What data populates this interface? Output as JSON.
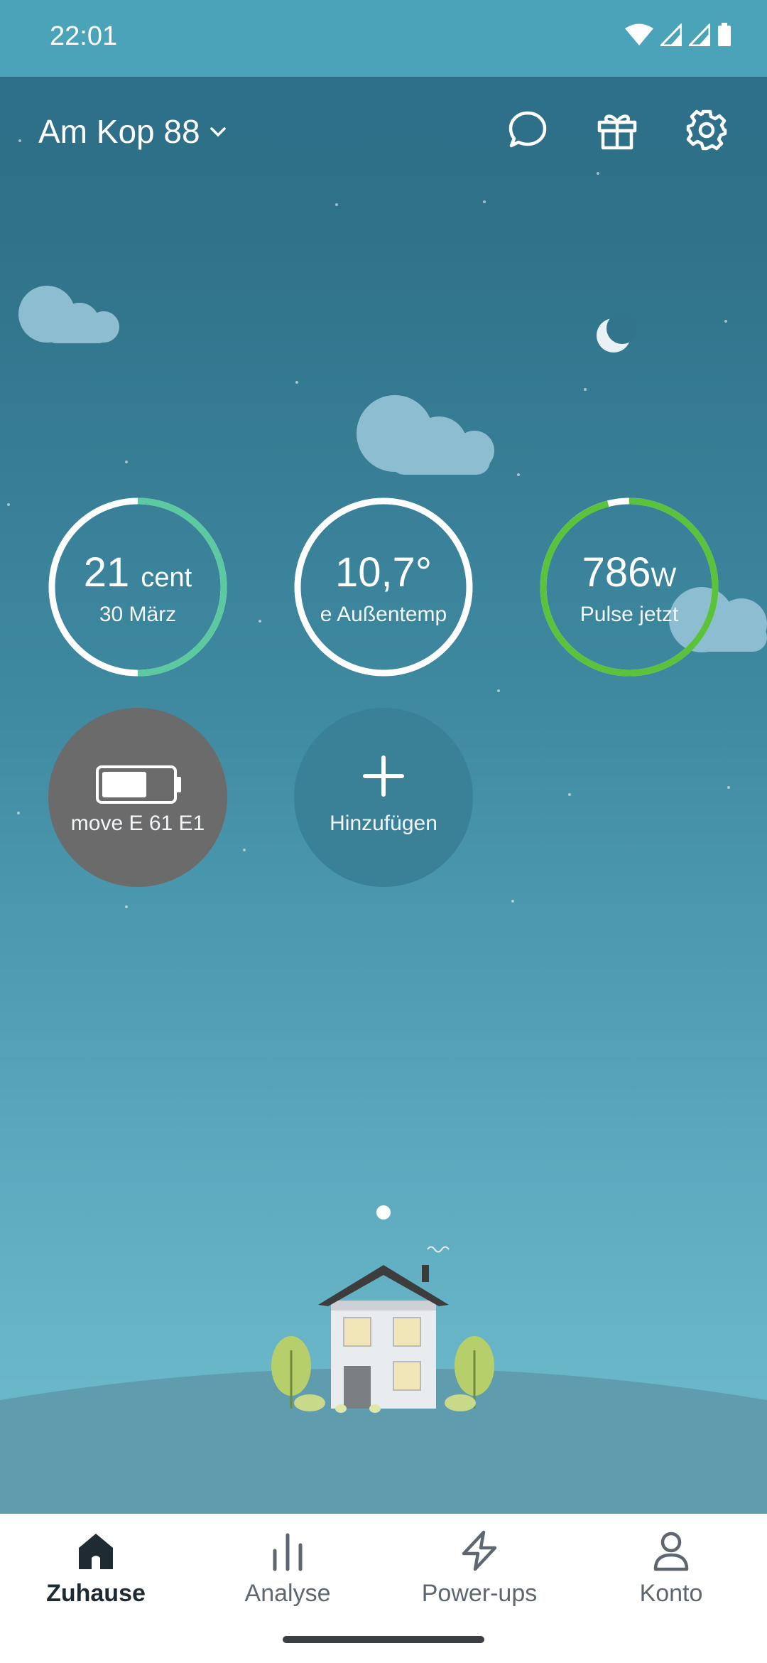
{
  "status_bar": {
    "time": "22:01"
  },
  "header": {
    "address": "Am Kop 88"
  },
  "tiles": [
    {
      "value": "21",
      "unit": "cent",
      "subtitle": "30 März",
      "progress": 0.5,
      "ring_color": "#5cc9a0"
    },
    {
      "value": "10,7°",
      "subtitle": "e Außentemp",
      "ring_color": "#ffffff"
    },
    {
      "value": "786",
      "unit": "W",
      "subtitle": "Pulse jetzt",
      "progress": 0.96,
      "ring_color": "#5ac23b"
    },
    {
      "subtitle": "move E 61 E1"
    },
    {
      "subtitle": "Hinzufügen"
    }
  ],
  "pager": {
    "page": 1,
    "pages": 1
  },
  "nav": {
    "items": [
      {
        "label": "Zuhause",
        "icon": "home-icon",
        "active": true
      },
      {
        "label": "Analyse",
        "icon": "bar-chart-icon"
      },
      {
        "label": "Power-ups",
        "icon": "lightning-icon"
      },
      {
        "label": "Konto",
        "icon": "person-icon"
      }
    ]
  },
  "colors": {
    "status_bar": "#4aa3b8",
    "sky_top": "#2e6f89",
    "hill": "#5f9dae"
  }
}
